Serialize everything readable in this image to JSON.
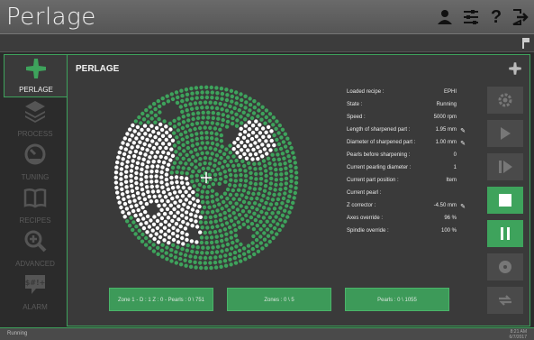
{
  "app": {
    "title": "Perlage"
  },
  "header_icons": [
    "user-icon",
    "settings-sliders-icon",
    "help-icon",
    "logout-icon"
  ],
  "sidebar": {
    "items": [
      {
        "label": "PERLAGE",
        "icon": "perlage-icon",
        "active": true
      },
      {
        "label": "PROCESS",
        "icon": "layers-icon",
        "active": false
      },
      {
        "label": "TUNING",
        "icon": "gauge-icon",
        "active": false
      },
      {
        "label": "RECIPES",
        "icon": "book-icon",
        "active": false
      },
      {
        "label": "ADVANCED",
        "icon": "zoom-plus-icon",
        "active": false
      },
      {
        "label": "ALARM",
        "icon": "alarm-sign-icon",
        "active": false
      }
    ]
  },
  "panel": {
    "title": "PERLAGE"
  },
  "info": [
    {
      "label": "Loaded recipe :",
      "value": "EPHI",
      "edit": false
    },
    {
      "label": "State :",
      "value": "Running",
      "edit": false
    },
    {
      "label": "Speed :",
      "value": "5000  rpm",
      "edit": false
    },
    {
      "label": "Length of sharpened part :",
      "value": "1.95  mm",
      "edit": true
    },
    {
      "label": "Diameter of sharpened part :",
      "value": "1.00  mm",
      "edit": true
    },
    {
      "label": "Pearls before sharpening :",
      "value": "0",
      "edit": false
    },
    {
      "label": "Current pearling diameter :",
      "value": "1",
      "edit": false
    },
    {
      "label": "Current part position :",
      "value": "Item",
      "edit": false
    },
    {
      "label": "Current pearl :",
      "value": "",
      "edit": false
    },
    {
      "label": "Z corrector :",
      "value": "-4.50  mm",
      "edit": true
    },
    {
      "label": "Axes override :",
      "value": "96  %",
      "edit": false
    },
    {
      "label": "Spindle override :",
      "value": "100  %",
      "edit": false
    }
  ],
  "counters": [
    {
      "text": "Zone 1 - D : 1 Z : 0  -  Pearls  :  0 \\ 751"
    },
    {
      "text": "Zones  :  0 \\ 5"
    },
    {
      "text": "Pearls  :  0 \\ 1055"
    }
  ],
  "controls": [
    {
      "icon": "gear-icon",
      "color": "gray"
    },
    {
      "icon": "play-icon",
      "color": "gray"
    },
    {
      "icon": "step-play-icon",
      "color": "gray"
    },
    {
      "icon": "stop-icon",
      "color": "green"
    },
    {
      "icon": "pause-icon",
      "color": "green"
    },
    {
      "icon": "target-icon",
      "color": "gray"
    },
    {
      "icon": "refresh-icon",
      "color": "gray"
    }
  ],
  "status": {
    "text": "Running",
    "time": "8:21 AM",
    "date": "6/7/2017"
  },
  "colors": {
    "accent": "#3ea35c",
    "pearl_done": "#ffffff",
    "pearl_todo": "#3ea35c",
    "background": "#3a3a3a"
  }
}
